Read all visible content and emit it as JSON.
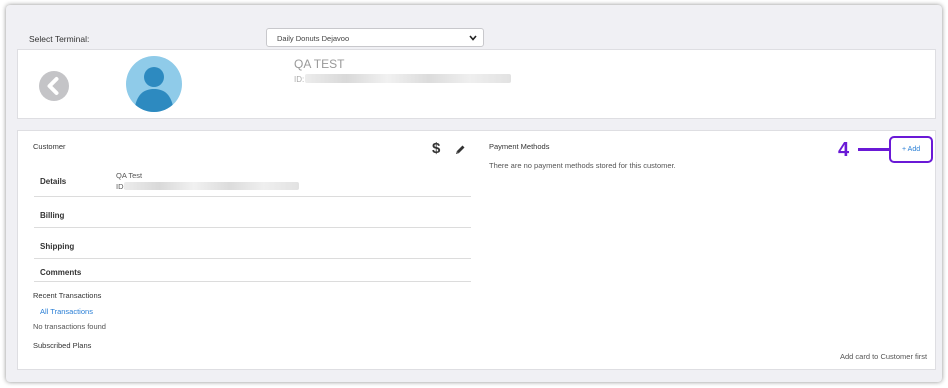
{
  "header": {
    "terminal_label": "Select Terminal:",
    "terminal_selected": "Daily Donuts Dejavoo"
  },
  "profile": {
    "name": "QA TEST",
    "id_label": "ID:"
  },
  "customer": {
    "title": "Customer",
    "rows": {
      "details": "Details",
      "billing": "Billing",
      "shipping": "Shipping",
      "comments": "Comments"
    },
    "details_name": "QA Test",
    "details_id_label": "ID:"
  },
  "transactions": {
    "title": "Recent Transactions",
    "all_link": "All Transactions",
    "empty": "No transactions found"
  },
  "plans": {
    "title": "Subscribed Plans",
    "hint": "Add card to Customer first"
  },
  "payment": {
    "title": "Payment Methods",
    "empty": "There are no payment methods stored for this customer.",
    "add_label": "+ Add"
  },
  "annotation": {
    "step_number": "4",
    "color": "#6a19d6"
  },
  "icons": [
    "chevron-down-icon",
    "back-arrow-icon",
    "avatar-icon",
    "dollar-icon",
    "pencil-icon"
  ]
}
